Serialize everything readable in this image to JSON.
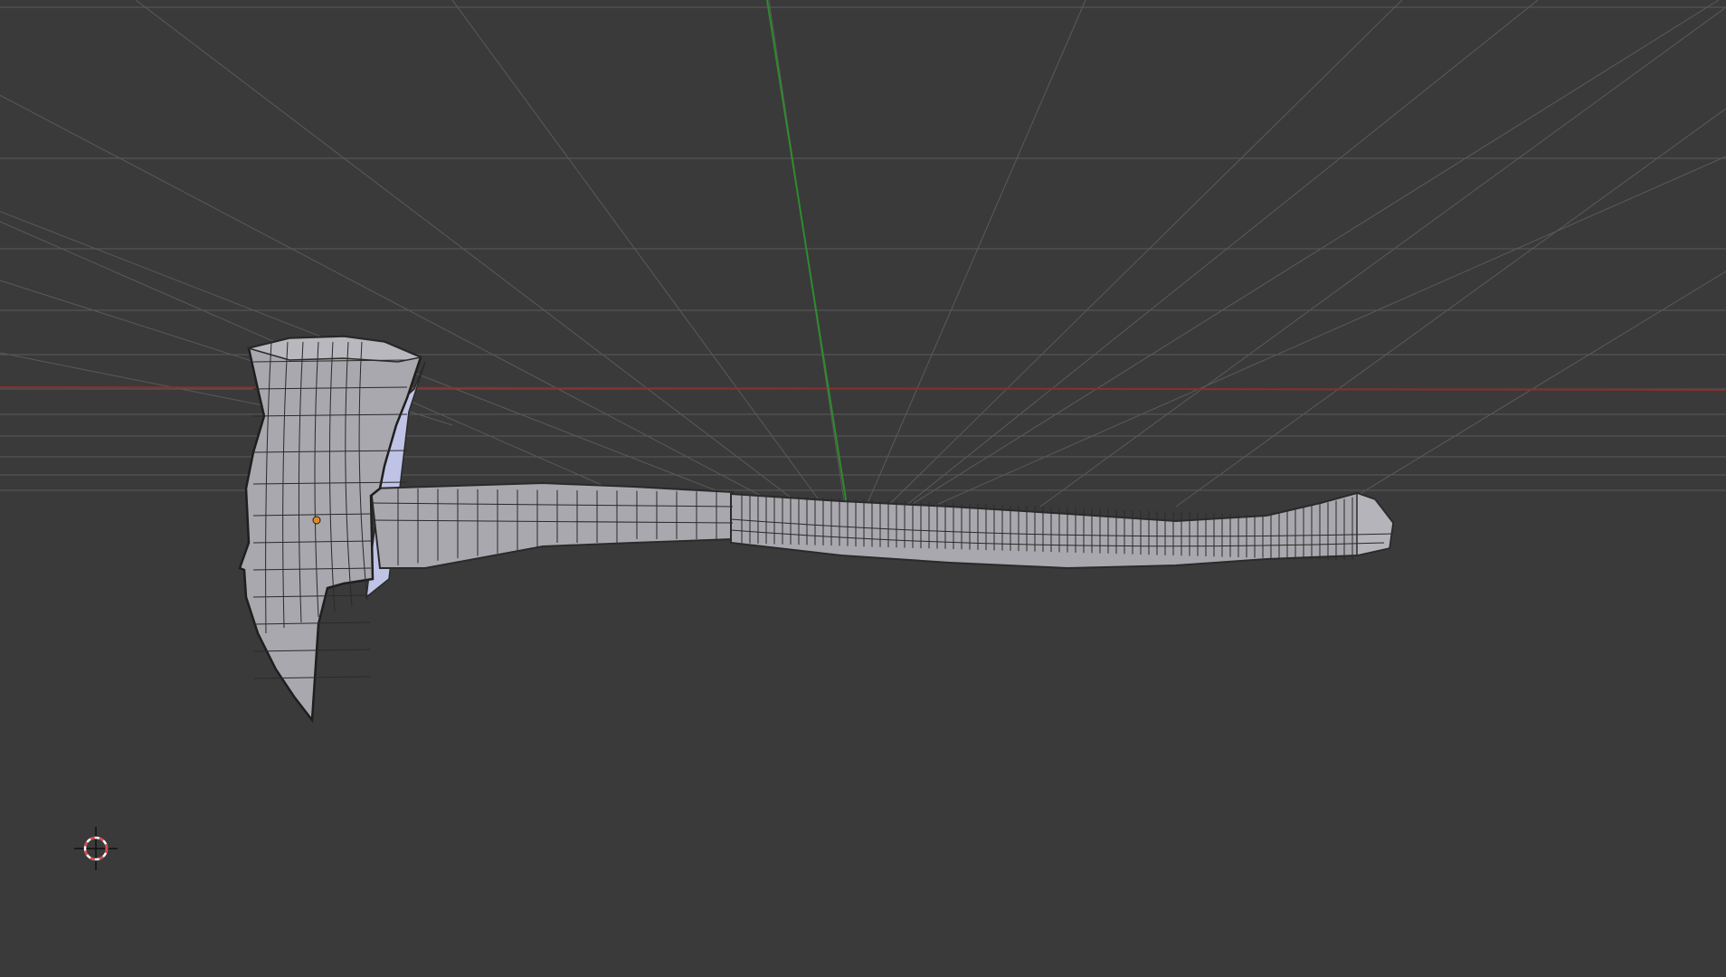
{
  "viewport": {
    "name": "3d-viewport",
    "background": "#3a3a3a",
    "grid_color": "#5a5a5a",
    "x_axis_color": "#8a2e2e",
    "y_axis_color": "#2f8a2f"
  },
  "model": {
    "name": "axe-mesh",
    "fill": "#a8a8ae",
    "fill_light": "#c2c2c8",
    "highlight": "#bfc3e6",
    "wire": "#2a2a2a",
    "origin_color": "#e08a2a"
  },
  "cursor": {
    "icon": "3d-cursor-icon",
    "ring_red": "#d84a4a",
    "ring_white": "#ffffff"
  }
}
